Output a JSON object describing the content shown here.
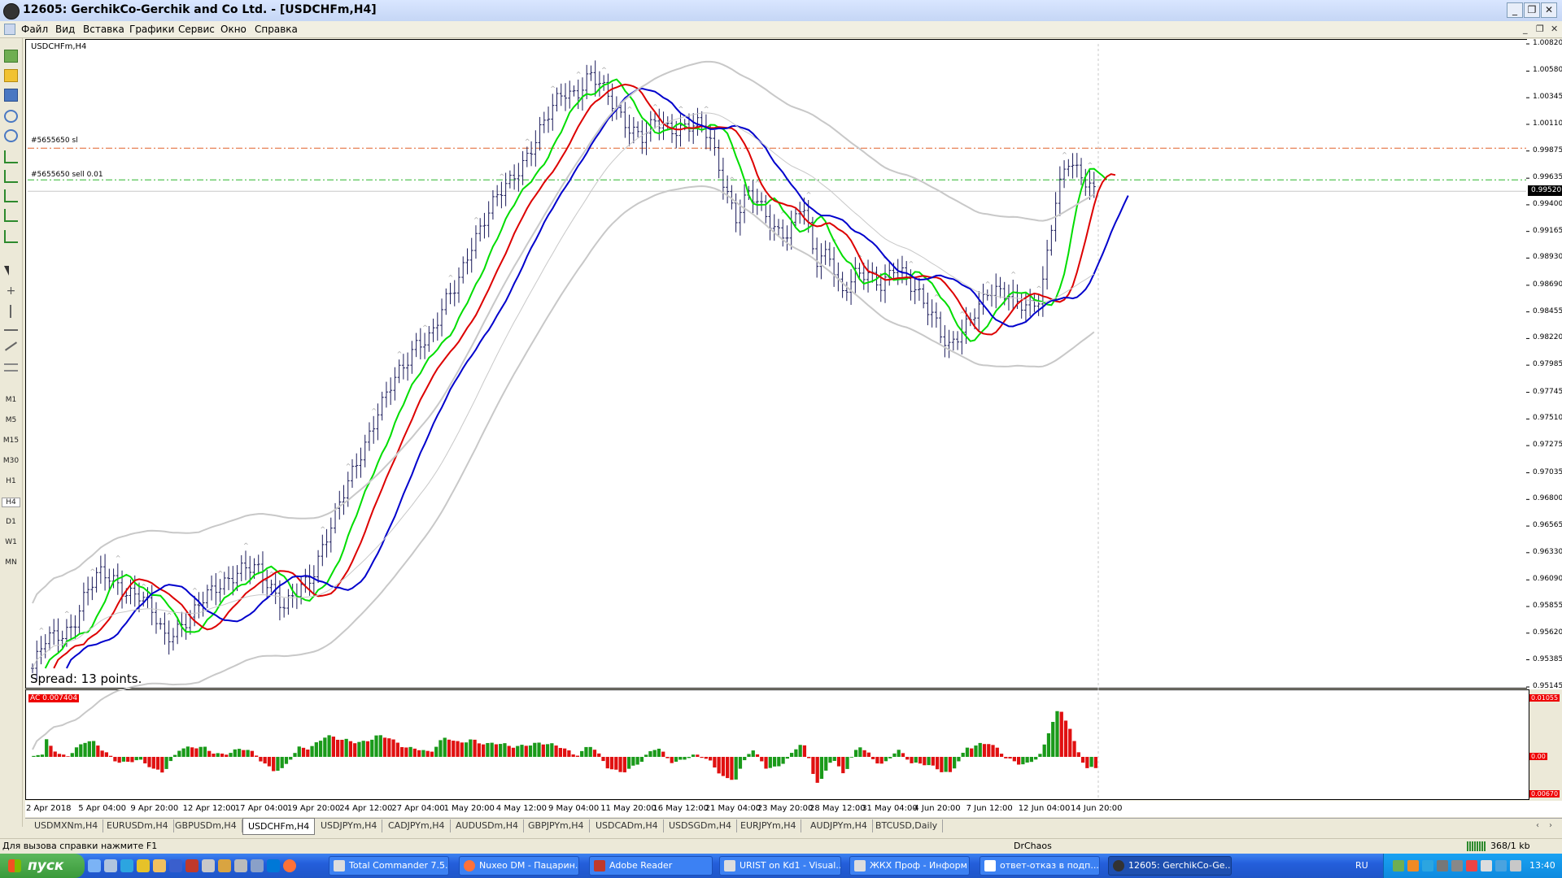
{
  "window": {
    "title": "12605: GerchikCo-Gerchik and Co Ltd. - [USDCHFm,H4]",
    "controls": [
      "_",
      "❐",
      "✕"
    ]
  },
  "menu": {
    "items": [
      "Файл",
      "Вид",
      "Вставка",
      "Графики",
      "Сервис",
      "Окно",
      "Справка"
    ],
    "mdi_controls": [
      "_",
      "❐",
      "✕"
    ]
  },
  "toolbar": {
    "timeframes": [
      "M1",
      "M5",
      "M15",
      "M30",
      "H1",
      "H4",
      "D1",
      "W1",
      "MN"
    ],
    "active_timeframe": "H4"
  },
  "chart": {
    "symbol_label": "USDCHFm,H4",
    "spread_text": "Spread: 13 points.",
    "current_price": "0.99520",
    "order_lines": [
      {
        "label": "#5655650 sl",
        "price": 0.999,
        "color": "#e0602a"
      },
      {
        "label": "#5655650 sell 0.01",
        "price": 0.9962,
        "color": "#2db52d"
      }
    ],
    "colors": {
      "bullish_ac": "#1a9a1a",
      "bearish_ac": "#e01010",
      "ma_fast": "#00dd00",
      "ma_mid": "#dd0000",
      "ma_slow": "#0000cc",
      "bands": "#c8c8c8",
      "fractals": "#a0a0a0"
    }
  },
  "indicator": {
    "label": "AC 0.007404",
    "axis_top": "0.01055",
    "axis_zero": "0.00",
    "axis_bottom": "0.00670"
  },
  "chart_data": {
    "type": "ohlc",
    "price_axis_ticks": [
      "1.00820",
      "1.00580",
      "1.00345",
      "1.00110",
      "0.99875",
      "0.99635",
      "0.99400",
      "0.99165",
      "0.98930",
      "0.98690",
      "0.98455",
      "0.98220",
      "0.97985",
      "0.97745",
      "0.97510",
      "0.97275",
      "0.97035",
      "0.96800",
      "0.96565",
      "0.96330",
      "0.96090",
      "0.95855",
      "0.95620",
      "0.95385",
      "0.95145"
    ],
    "time_axis_ticks": [
      "2 Apr 2018",
      "5 Apr 04:00",
      "9 Apr 20:00",
      "12 Apr 12:00",
      "17 Apr 04:00",
      "19 Apr 20:00",
      "24 Apr 12:00",
      "27 Apr 04:00",
      "1 May 20:00",
      "4 May 12:00",
      "9 May 04:00",
      "11 May 20:00",
      "16 May 12:00",
      "21 May 04:00",
      "23 May 20:00",
      "28 May 12:00",
      "31 May 04:00",
      "4 Jun 20:00",
      "7 Jun 12:00",
      "12 Jun 04:00",
      "14 Jun 20:00"
    ],
    "ylim": [
      0.95145,
      1.0082
    ],
    "price_path": [
      [
        0.9531,
        0.9555
      ],
      [
        0.956,
        0.957
      ],
      [
        0.9596,
        0.9613
      ],
      [
        0.9612,
        0.96
      ],
      [
        0.9594,
        0.958
      ],
      [
        0.956,
        0.9568
      ],
      [
        0.9574,
        0.9594
      ],
      [
        0.9607,
        0.9612
      ],
      [
        0.9617,
        0.9618
      ],
      [
        0.9604,
        0.9585
      ],
      [
        0.9597,
        0.961
      ],
      [
        0.9646,
        0.9672
      ],
      [
        0.9698,
        0.9727
      ],
      [
        0.976,
        0.978
      ],
      [
        0.9795,
        0.982
      ],
      [
        0.9826,
        0.985
      ],
      [
        0.9868,
        0.9905
      ],
      [
        0.9927,
        0.9945
      ],
      [
        0.996,
        0.998
      ],
      [
        1.0,
        1.002
      ],
      [
        1.004,
        1.004
      ],
      [
        1.0055,
        1.004
      ],
      [
        1.0025,
        1.001
      ],
      [
        0.9998,
        1.0012
      ],
      [
        1.0008,
        1.001
      ],
      [
        1.001,
        0.9999
      ],
      [
        0.9965,
        0.993
      ],
      [
        0.9948,
        0.9935
      ],
      [
        0.992,
        0.9915
      ],
      [
        0.994,
        0.989
      ],
      [
        0.9902,
        0.986
      ],
      [
        0.9875,
        0.988
      ],
      [
        0.9872,
        0.9885
      ],
      [
        0.9868,
        0.986
      ],
      [
        0.9842,
        0.981
      ],
      [
        0.9825,
        0.9848
      ],
      [
        0.9866,
        0.986
      ],
      [
        0.9855,
        0.9853
      ],
      [
        0.986
      ],
      [
        0.9935,
        0.998
      ],
      [
        0.997,
        0.9952
      ]
    ]
  },
  "tabs": {
    "items": [
      "USDMXNm,H4",
      "EURUSDm,H4",
      "GBPUSDm,H4",
      "USDCHFm,H4",
      "USDJPYm,H4",
      "CADJPYm,H4",
      "AUDUSDm,H4",
      "GBPJPYm,H4",
      "USDCADm,H4",
      "USDSGDm,H4",
      "EURJPYm,H4",
      "AUDJPYm,H4",
      "BTCUSD,Daily"
    ],
    "active": "USDCHFm,H4"
  },
  "status": {
    "help_text": "Для вызова справки нажмите F1",
    "profile": "DrChaos",
    "traffic": "368/1 kb"
  },
  "taskbar": {
    "start_label": "пуск",
    "windows": [
      "Total Commander 7.5...",
      "Nuxeo DM - Пацарин...",
      "Adobe Reader",
      "URIST on Kd1 - Visual...",
      "ЖКХ Проф - Информ ©",
      "ответ-отказ в подп...",
      "12605: GerchikCo-Ge..."
    ],
    "active_window": "12605: GerchikCo-Ge...",
    "language": "RU",
    "clock": "13:40"
  }
}
